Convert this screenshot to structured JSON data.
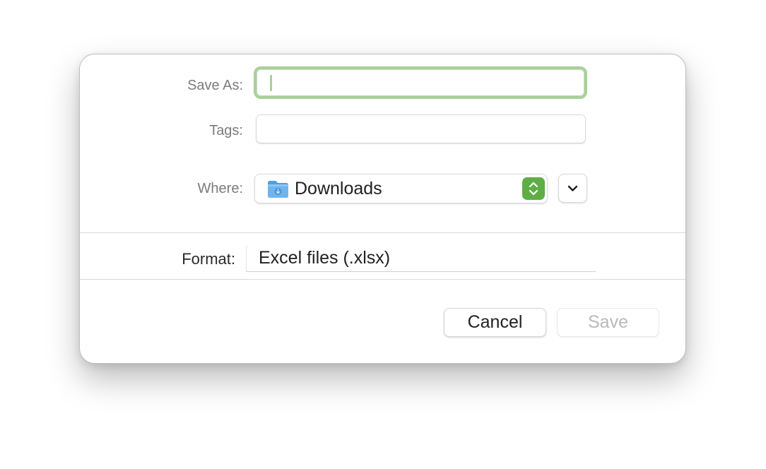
{
  "dialog": {
    "save_as": {
      "label": "Save As:",
      "value": ""
    },
    "tags": {
      "label": "Tags:",
      "value": ""
    },
    "where": {
      "label": "Where:",
      "value": "Downloads",
      "icon": "downloads-folder-icon"
    },
    "format": {
      "label": "Format:",
      "value": "Excel files (.xlsx)"
    },
    "buttons": {
      "cancel": "Cancel",
      "save": "Save"
    }
  },
  "colors": {
    "focus_ring": "#a9d09a",
    "stepper_accent": "#5fae45",
    "folder_blue": "#6aaee8",
    "disabled_text": "#b9b9b9"
  }
}
